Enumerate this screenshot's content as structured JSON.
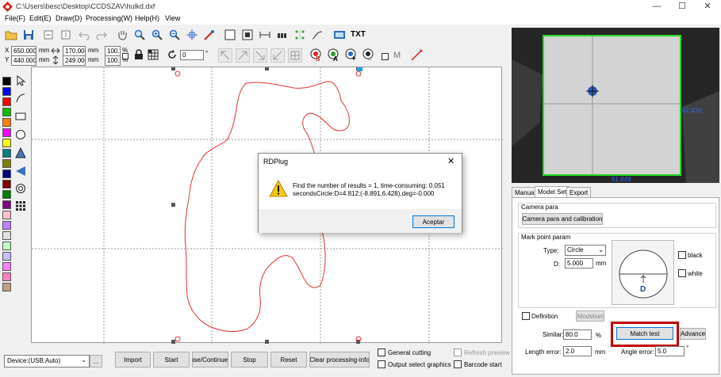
{
  "window": {
    "title": "C:\\Users\\besc\\Desktop\\CCDSZAV\\hulkd.dxf",
    "minimize": "—",
    "maximize": "☐",
    "close": "✕"
  },
  "menu": [
    "File(F)",
    "Edit(E)",
    "Draw(D)",
    "Processing(W)",
    "Help(H)",
    "View"
  ],
  "toolbar": {
    "txt_label": "TXT"
  },
  "coords": {
    "x_label": "X",
    "y_label": "Y",
    "x_value": "650.000",
    "y_value": "440.000",
    "unit": "mm",
    "width_value": "170.000",
    "height_value": "249.000",
    "pct_w": "100.0",
    "pct_h": "100.0",
    "pct": "%",
    "rotate_value": "0",
    "deg": "°"
  },
  "markers": {
    "s": "S",
    "a": "A",
    "plus": "+",
    "minus": "_",
    "m": "M"
  },
  "palette": [
    "#000000",
    "#0000ff",
    "#ff0000",
    "#00c000",
    "#ff8000",
    "#ff00ff",
    "#ffff00",
    "#008080",
    "#808000",
    "#000080",
    "#800000",
    "#008000",
    "#800080",
    "#ffc0cb",
    "#c080ff",
    "#e0e0e0",
    "#c0ffc0",
    "#c0c0ff",
    "#ff80ff",
    "#ff80c0",
    "#c0a080"
  ],
  "dialog": {
    "title": "RDPlug",
    "line1": "Find the number of results = 1, time-consuming: 0.051",
    "line2": "secondsCircle:D=4.812;(-8.891,6.428),deg=-0.000",
    "ok": "Aceptar",
    "close": "✕"
  },
  "bottom": {
    "device": "Device:(USB:Auto)",
    "more": "...",
    "import": "Import",
    "start": "Start",
    "pause": "Pause/Continue",
    "stop": "Stop",
    "reset": "Reset",
    "clear": "Clear processing-info",
    "general_cutting": "General cutting",
    "output_select": "Output select graphics",
    "refresh_preview": "Refresh preview",
    "barcode_start": "Barcode start"
  },
  "camera": {
    "value_right": "62.433",
    "value_bottom": "61.849",
    "box_color": "#22dd22"
  },
  "tabs": [
    "Manual",
    "Model Set",
    "Export"
  ],
  "panel": {
    "camera_para_group": "Camera para",
    "camera_btn": "Camera para and calibration",
    "mark_group": "Mark point param",
    "type_label": "Type:",
    "type_value": "Circle",
    "d_label": "D:",
    "d_value": "5.000",
    "mm": "mm",
    "d_glyph": "D",
    "black": "black",
    "white": "white",
    "definition": "Definition",
    "modelset": "Modelset",
    "similar_label": "Similar:",
    "similar_value": "80.0",
    "pct": "%",
    "match_test": "Match test",
    "advance": "Advance",
    "length_label": "Length error:",
    "length_value": "2.0",
    "angle_label": "Angle error:",
    "angle_value": "5.0",
    "deg": "°"
  },
  "colors": {
    "highlight": "#c00000",
    "outline": "#e83030"
  }
}
